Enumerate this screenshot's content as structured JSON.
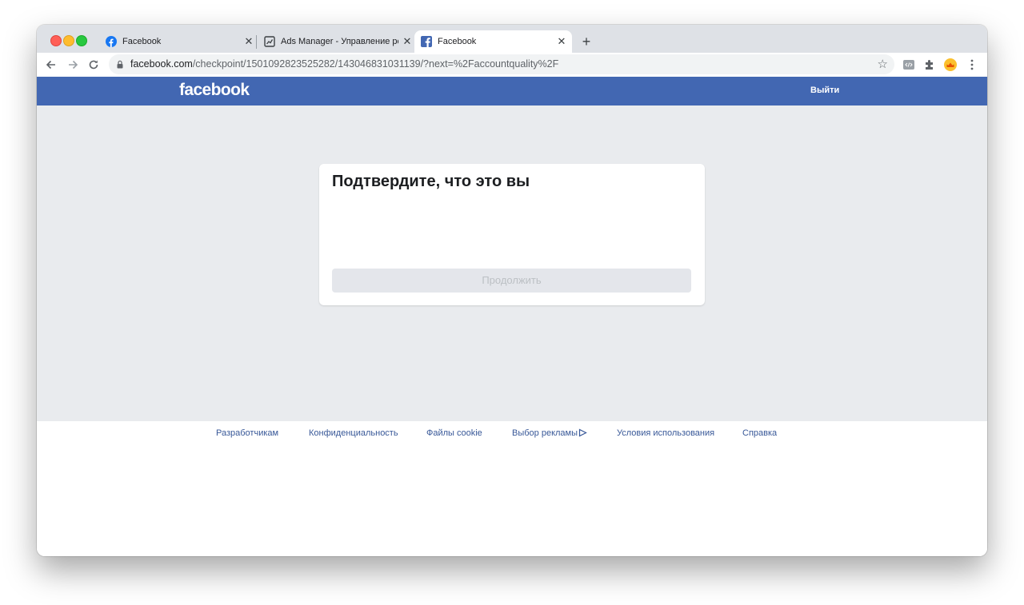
{
  "browser": {
    "tabs": [
      {
        "title": "Facebook",
        "active": false
      },
      {
        "title": "Ads Manager - Управление ре",
        "active": false
      },
      {
        "title": "Facebook",
        "active": true
      }
    ],
    "url_host": "facebook.com",
    "url_path": "/checkpoint/1501092823525282/143046831031139/?next=%2Faccountquality%2F"
  },
  "header": {
    "logo": "facebook",
    "logout_label": "Выйти",
    "color": "#4267b2"
  },
  "card": {
    "title": "Подтвердите, что это вы",
    "continue_label": "Продолжить"
  },
  "footer": {
    "links": [
      "Разработчикам",
      "Конфиденциальность",
      "Файлы cookie",
      "Выбор рекламы",
      "Условия использования",
      "Справка"
    ]
  },
  "icons": [
    "back-arrow-icon",
    "forward-arrow-icon",
    "reload-icon",
    "lock-icon",
    "star-icon",
    "extension-puzzle-icon",
    "more-vert-icon",
    "adchoices-icon"
  ]
}
